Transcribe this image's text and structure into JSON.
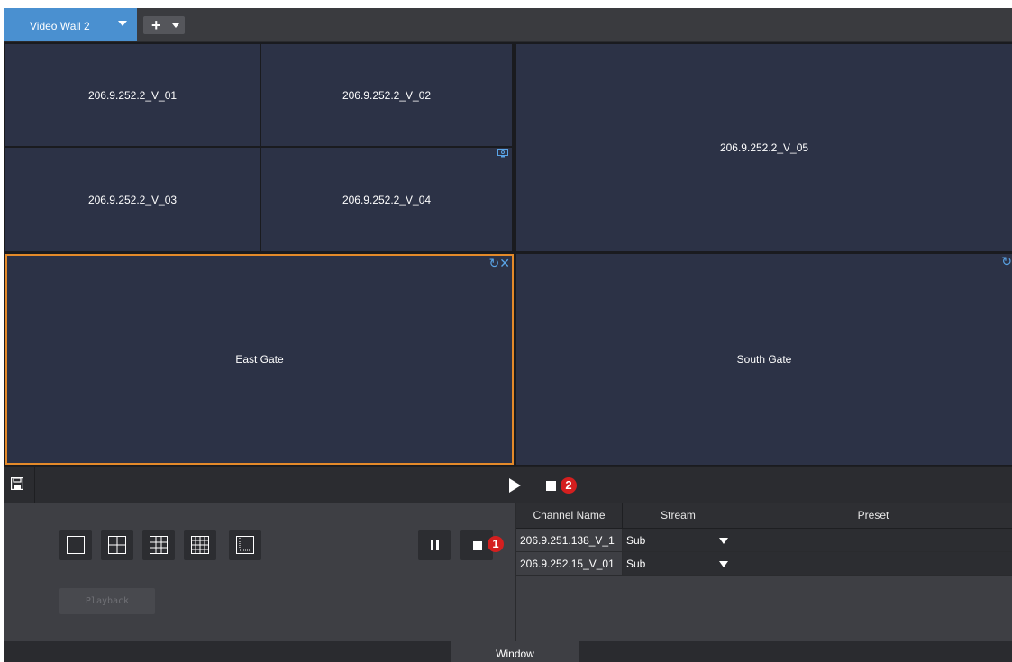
{
  "topbar": {
    "active_tab": "Video Wall 2"
  },
  "wall": {
    "panes": [
      {
        "label": "206.9.252.2_V_01"
      },
      {
        "label": "206.9.252.2_V_02"
      },
      {
        "label": "206.9.252.2_V_03"
      },
      {
        "label": "206.9.252.2_V_04"
      },
      {
        "label": "206.9.252.2_V_05"
      },
      {
        "label": "East Gate"
      },
      {
        "label": "South Gate"
      }
    ],
    "selected_pane": "East Gate",
    "selection_color": "#e48a2a",
    "pane_color": "#2c3246"
  },
  "controls": {
    "badge_1": "1",
    "badge_2": "2",
    "playback_label": "Playback"
  },
  "table": {
    "headers": [
      "Channel Name",
      "Stream",
      "Preset"
    ],
    "rows": [
      {
        "channel": "206.9.251.138_V_1",
        "stream": "Sub",
        "preset": ""
      },
      {
        "channel": "206.9.252.15_V_01",
        "stream": "Sub",
        "preset": ""
      }
    ]
  },
  "footer": {
    "tab": "Window"
  },
  "colors": {
    "accent": "#4a90d0",
    "badge": "#d41f1f",
    "icon_blue": "#5aa4e6"
  }
}
